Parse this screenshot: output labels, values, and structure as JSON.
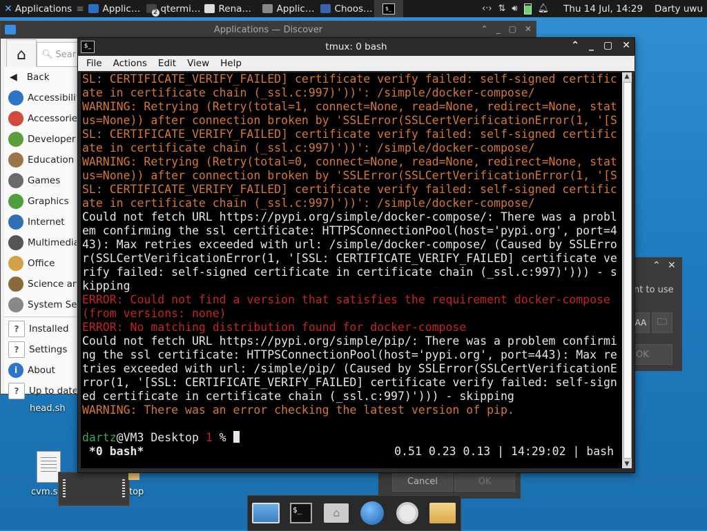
{
  "top_panel": {
    "apps_label": "Applications",
    "tasks": [
      {
        "label": "Applic…",
        "icon": "discover-icon",
        "color": "#2a6fc4"
      },
      {
        "label": "qtermi…",
        "icon": "terminal-icon",
        "color": "#444444",
        "badge": "2"
      },
      {
        "label": "Rena…",
        "icon": "folder-icon",
        "color": "#dddddd"
      },
      {
        "label": "Applic…",
        "icon": "search-icon",
        "color": "#888888"
      },
      {
        "label": "Choos…",
        "icon": "window-icon",
        "color": "#3a63b0"
      }
    ],
    "clock": "Thu 14 Jul, 14:29",
    "user": "Darty uwu"
  },
  "discover": {
    "title": "Applications — Discover",
    "search_placeholder": "Sear",
    "back_label": "Back",
    "categories": [
      {
        "label": "Accessibility",
        "icon": "accessibility-icon",
        "color": "#2b74c7"
      },
      {
        "label": "Accessories",
        "icon": "accessories-icon",
        "color": "#d24a3c"
      },
      {
        "label": "Developer",
        "icon": "developer-icon",
        "color": "#5a9e3a"
      },
      {
        "label": "Education",
        "icon": "education-icon",
        "color": "#a0744a"
      },
      {
        "label": "Games",
        "icon": "games-icon",
        "color": "#6a6a6a"
      },
      {
        "label": "Graphics",
        "icon": "graphics-icon",
        "color": "#4f9e3c"
      },
      {
        "label": "Internet",
        "icon": "internet-icon",
        "color": "#2f6fb8"
      },
      {
        "label": "Multimedia",
        "icon": "multimedia-icon",
        "color": "#555555"
      },
      {
        "label": "Office",
        "icon": "office-icon",
        "color": "#d3a044"
      },
      {
        "label": "Science and",
        "icon": "science-icon",
        "color": "#8a6a3a"
      },
      {
        "label": "System Se",
        "icon": "system-settings-icon",
        "color": "#888888"
      }
    ],
    "bottom_items": [
      {
        "label": "Installed",
        "icon": "installed-icon"
      },
      {
        "label": "Settings",
        "icon": "settings-icon"
      },
      {
        "label": "About",
        "icon": "about-icon"
      },
      {
        "label": "Up to date",
        "icon": "update-icon"
      }
    ]
  },
  "dialog_right": {
    "text": "nt to use",
    "b1": "AA",
    "ok": "OK"
  },
  "dialog_bottom": {
    "cancel": "Cancel",
    "ok": "OK"
  },
  "desktop_icons": [
    {
      "label": "head.sh"
    },
    {
      "label": "cvm.s"
    },
    {
      "label": "top"
    }
  ],
  "terminal": {
    "title": "tmux: 0 bash",
    "menu": [
      "File",
      "Actions",
      "Edit",
      "View",
      "Help"
    ],
    "lines": [
      {
        "c": "orange",
        "t": "SL: CERTIFICATE_VERIFY_FAILED] certificate verify failed: self-signed certific"
      },
      {
        "c": "orange",
        "t": "ate in certificate chain (_ssl.c:997)'))': /simple/docker-compose/"
      },
      {
        "c": "orange",
        "t": "WARNING: Retrying (Retry(total=1, connect=None, read=None, redirect=None, stat"
      },
      {
        "c": "orange",
        "t": "us=None)) after connection broken by 'SSLError(SSLCertVerificationError(1, '[S"
      },
      {
        "c": "orange",
        "t": "SL: CERTIFICATE_VERIFY_FAILED] certificate verify failed: self-signed certific"
      },
      {
        "c": "orange",
        "t": "ate in certificate chain (_ssl.c:997)'))': /simple/docker-compose/"
      },
      {
        "c": "orange",
        "t": "WARNING: Retrying (Retry(total=0, connect=None, read=None, redirect=None, stat"
      },
      {
        "c": "orange",
        "t": "us=None)) after connection broken by 'SSLError(SSLCertVerificationError(1, '[S"
      },
      {
        "c": "orange",
        "t": "SL: CERTIFICATE_VERIFY_FAILED] certificate verify failed: self-signed certific"
      },
      {
        "c": "orange",
        "t": "ate in certificate chain (_ssl.c:997)'))': /simple/docker-compose/"
      },
      {
        "c": "white",
        "t": "Could not fetch URL https://pypi.org/simple/docker-compose/: There was a probl"
      },
      {
        "c": "white",
        "t": "em confirming the ssl certificate: HTTPSConnectionPool(host='pypi.org', port=4"
      },
      {
        "c": "white",
        "t": "43): Max retries exceeded with url: /simple/docker-compose/ (Caused by SSLErro"
      },
      {
        "c": "white",
        "t": "r(SSLCertVerificationError(1, '[SSL: CERTIFICATE_VERIFY_FAILED] certificate ve"
      },
      {
        "c": "white",
        "t": "rify failed: self-signed certificate in certificate chain (_ssl.c:997)'))) - s"
      },
      {
        "c": "white",
        "t": "kipping"
      },
      {
        "c": "red",
        "t": "ERROR: Could not find a version that satisfies the requirement docker-compose"
      },
      {
        "c": "red",
        "t": "(from versions: none)"
      },
      {
        "c": "red",
        "t": "ERROR: No matching distribution found for docker-compose"
      },
      {
        "c": "white",
        "t": "Could not fetch URL https://pypi.org/simple/pip/: There was a problem confirmi"
      },
      {
        "c": "white",
        "t": "ng the ssl certificate: HTTPSConnectionPool(host='pypi.org', port=443): Max re"
      },
      {
        "c": "white",
        "t": "tries exceeded with url: /simple/pip/ (Caused by SSLError(SSLCertVerificationE"
      },
      {
        "c": "white",
        "t": "rror(1, '[SSL: CERTIFICATE_VERIFY_FAILED] certificate verify failed: self-sign"
      },
      {
        "c": "white",
        "t": "ed certificate in certificate chain (_ssl.c:997)'))) - skipping"
      },
      {
        "c": "orange",
        "t": "WARNING: There was an error checking the latest version of pip."
      },
      {
        "c": "white",
        "t": ""
      }
    ],
    "prompt": {
      "user": "dartz",
      "host": "@VM3 Desktop ",
      "code": "1",
      "symbol": " % "
    },
    "status": {
      "left": " *0 bash*",
      "right": "0.51 0.23 0.13 | 14:29:02 | bash "
    }
  },
  "dock": [
    {
      "icon": "show-desktop-icon"
    },
    {
      "icon": "terminal-icon"
    },
    {
      "icon": "home-folder-icon"
    },
    {
      "icon": "web-browser-icon"
    },
    {
      "icon": "app-finder-icon"
    },
    {
      "icon": "file-manager-icon"
    }
  ]
}
